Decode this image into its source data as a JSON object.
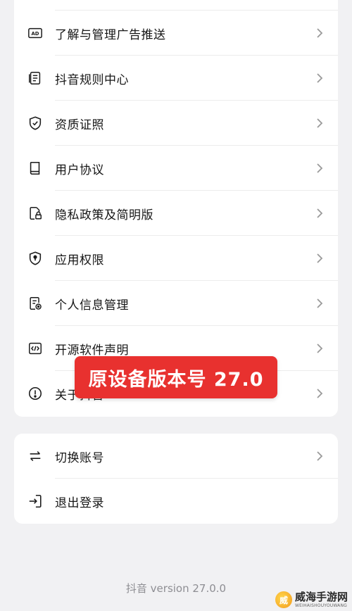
{
  "settings_list": {
    "items": [
      {
        "label": "了解与管理广告推送",
        "icon": "ad-icon"
      },
      {
        "label": "抖音规则中心",
        "icon": "document-list-icon"
      },
      {
        "label": "资质证照",
        "icon": "shield-check-icon"
      },
      {
        "label": "用户协议",
        "icon": "book-icon"
      },
      {
        "label": "隐私政策及简明版",
        "icon": "privacy-lock-icon"
      },
      {
        "label": "应用权限",
        "icon": "shield-keyhole-icon"
      },
      {
        "label": "个人信息管理",
        "icon": "personal-info-icon"
      },
      {
        "label": "开源软件声明",
        "icon": "code-icon"
      },
      {
        "label": "关于抖音",
        "icon": "info-icon"
      }
    ]
  },
  "account": {
    "items": [
      {
        "label": "切换账号",
        "icon": "switch-arrows-icon"
      },
      {
        "label": "退出登录",
        "icon": "logout-icon"
      }
    ]
  },
  "overlay_banner": {
    "text": "原设备版本号 27.0"
  },
  "footer": {
    "version": "抖音 version 27.0.0"
  },
  "watermark": {
    "name": "威海手游网",
    "url": "WEIHAISHOUYOUWANG",
    "logo_char": "威"
  },
  "colors": {
    "background": "#f1f1f3",
    "card": "#ffffff",
    "banner": "#e8312f",
    "chevron": "#9a9a9a"
  }
}
